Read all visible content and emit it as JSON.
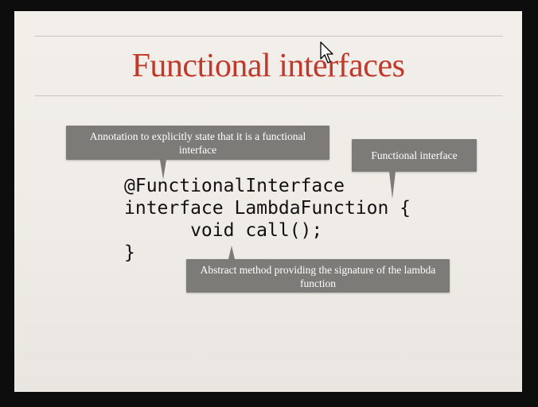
{
  "slide": {
    "title": "Functional interfaces",
    "code_lines": [
      "@FunctionalInterface",
      "interface LambdaFunction {",
      "      void call();",
      "}"
    ],
    "callouts": {
      "annotation": "Annotation to explicitly state that it is a functional interface",
      "functional_interface": "Functional interface",
      "abstract_method": "Abstract method providing the signature of the lambda function"
    }
  },
  "colors": {
    "title": "#c0392b",
    "callout_bg": "#7d7b78",
    "background": "#0d0d0d"
  },
  "icons": {
    "cursor": "mouse-pointer-icon"
  }
}
